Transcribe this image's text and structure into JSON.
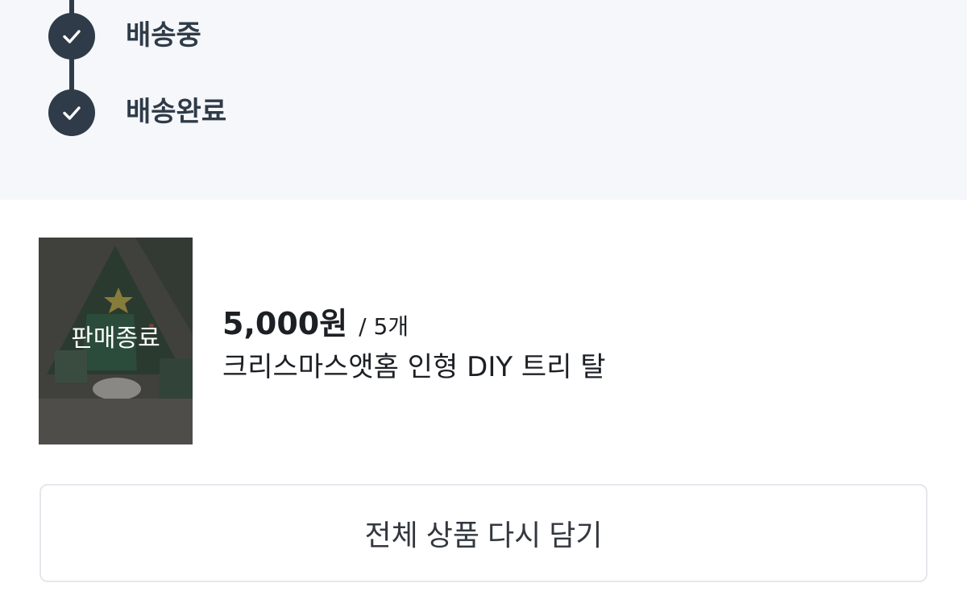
{
  "timeline": {
    "steps": [
      {
        "label": "배송중",
        "done": true
      },
      {
        "label": "배송완료",
        "done": true
      }
    ],
    "accent_color": "#2f3b48",
    "check_icon": "check-icon"
  },
  "product": {
    "thumbnail_overlay": "판매종료",
    "price": "5,000원",
    "quantity": "/ 5개",
    "name": "크리스마스앳홈 인형 DIY 트리 탈"
  },
  "actions": {
    "readd_all_label": "전체 상품 다시 담기"
  }
}
